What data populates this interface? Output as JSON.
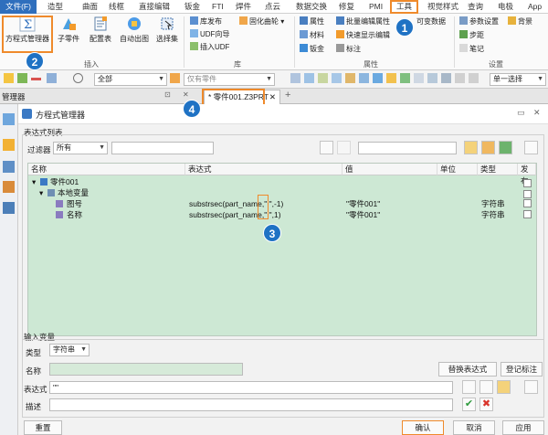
{
  "menubar": {
    "items": [
      "文件(F)",
      "造型",
      "曲面",
      "线框",
      "直接编辑",
      "钣金",
      "FTI",
      "焊件",
      "点云",
      "数据交换",
      "修复",
      "PMI",
      "工具",
      "视觉样式",
      "查询",
      "电极",
      "App"
    ]
  },
  "ribbon": {
    "big_buttons": [
      "方程式管理器",
      "子零件",
      "配置表",
      "自动出图",
      "选择集"
    ],
    "group_insert": "插入",
    "lib_items": [
      "库发布",
      "UDF向导",
      "插入UDF"
    ],
    "group_lib": "库",
    "mold_label": "固化曲轮",
    "prop_items": [
      "属性",
      "批量编辑属性",
      "材料",
      "快速显示编辑",
      "钣金",
      "标注"
    ],
    "group_props": "属性",
    "visible_data": "可变数据",
    "settings_items": [
      "参数设置",
      "背景",
      "步距",
      "笔记"
    ],
    "group_settings": "设置"
  },
  "quickbar": {
    "filter_value": "全部",
    "selection_hint": "仅有零件",
    "select_mode": "单一选择"
  },
  "tabbar": {
    "left_label": "管理器",
    "doc_tab": "* 零件001.Z3PRT",
    "close_glyph": "✕",
    "add_glyph": "+"
  },
  "dialog": {
    "title": "方程式管理器",
    "list_section": "表达式列表",
    "filter_label": "过滤器",
    "filter_value": "所有",
    "columns": [
      "名称",
      "表达式",
      "值",
      "单位",
      "类型",
      "发布"
    ],
    "rows": [
      {
        "name": "零件001",
        "expr": "",
        "value": "",
        "unit": "",
        "type": ""
      },
      {
        "name": "本地变量",
        "expr": "",
        "value": "",
        "unit": "",
        "type": ""
      },
      {
        "name": "图号",
        "expr": "substrsec(part_name,\" \",-1)",
        "value": "\"零件001\"",
        "unit": "",
        "type": "字符串"
      },
      {
        "name": "名称",
        "expr": "substrsec(part_name,\" \",1)",
        "value": "\"零件001\"",
        "unit": "",
        "type": "字符串"
      }
    ],
    "input_section": "输入变量",
    "type_label": "类型",
    "type_value": "字符串",
    "name_label": "名称",
    "replace_btn": "替换表达式",
    "register_btn": "登记标注",
    "expr_label": "表达式",
    "expr_value": "\"\"",
    "desc_label": "描述",
    "reset_btn": "重置",
    "ok_btn": "确认",
    "cancel_btn": "取消",
    "apply_btn": "应用"
  },
  "callouts": [
    "1",
    "2",
    "3",
    "4"
  ],
  "colors": {
    "accent": "#2f6fbd",
    "badge": "#1f72c4",
    "highlight": "#ef8a2b",
    "grid": "#cde8d4"
  }
}
